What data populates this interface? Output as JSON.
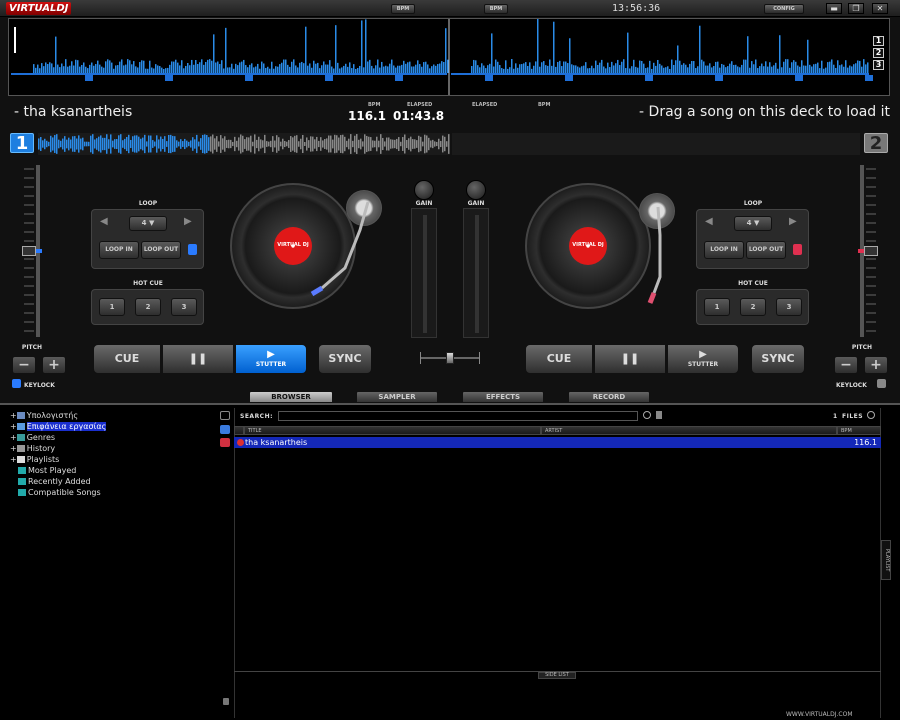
{
  "app": {
    "logo_virtual": "VIRTUAL",
    "logo_dj": "DJ",
    "top_buttons": [
      "BPM",
      "BPM",
      "CONFIG"
    ],
    "clock": "13:56:36",
    "win_buttons": [
      "▬",
      "❐",
      "✕"
    ],
    "url": "WWW.VIRTUALDJ.COM"
  },
  "overview": {
    "deck_selectors": [
      "1",
      "2",
      "3"
    ]
  },
  "deck_left": {
    "song": "- tha ksanartheis",
    "number": "1",
    "bpm_label": "BPM",
    "bpm": "116.1",
    "elapsed_label": "ELAPSED",
    "elapsed": "01:43.8",
    "pitch_label": "PITCH",
    "keylock_label": "KEYLOCK",
    "loop_label": "LOOP",
    "loop_value": "4",
    "loop_in": "LOOP IN",
    "loop_out": "LOOP OUT",
    "hotcue_label": "HOT CUE",
    "hotcues": [
      "1",
      "2",
      "3"
    ],
    "cue": "CUE",
    "pause": "❚❚",
    "stutter": "STUTTER",
    "sync": "SYNC",
    "minus": "−",
    "plus": "+",
    "gain_label": "GAIN",
    "disc_label": "VIRTUAL DJ",
    "accent": "#2a7bff"
  },
  "deck_right": {
    "song": "- Drag a song on this deck to load it",
    "number": "2",
    "elapsed_label": "ELAPSED",
    "bpm_label": "BPM",
    "pitch_label": "PITCH",
    "keylock_label": "KEYLOCK",
    "loop_label": "LOOP",
    "loop_value": "4",
    "loop_in": "LOOP IN",
    "loop_out": "LOOP OUT",
    "hotcue_label": "HOT CUE",
    "hotcues": [
      "1",
      "2",
      "3"
    ],
    "cue": "CUE",
    "pause": "❚❚",
    "stutter": "STUTTER",
    "sync": "SYNC",
    "minus": "−",
    "plus": "+",
    "gain_label": "GAIN",
    "disc_label": "VIRTUAL DJ",
    "accent": "#e03050"
  },
  "tabs": [
    "BROWSER",
    "SAMPLER",
    "EFFECTS",
    "RECORD"
  ],
  "browser": {
    "tree": [
      "Υπολογιστής",
      "Επιφάνεια εργασίας",
      "Genres",
      "History",
      "Playlists",
      "Most Played",
      "Recently Added",
      "Compatible Songs"
    ],
    "search_label": "SEARCH:",
    "files_count": "1",
    "files_label": "FILES",
    "columns": [
      "TITLE",
      "ARTIST",
      "BPM"
    ],
    "rows": [
      {
        "title": "tha ksanartheis",
        "artist": "",
        "bpm": "116.1"
      }
    ],
    "side_list": "SIDE LIST",
    "playlist_tab": "PLAYLIST"
  }
}
